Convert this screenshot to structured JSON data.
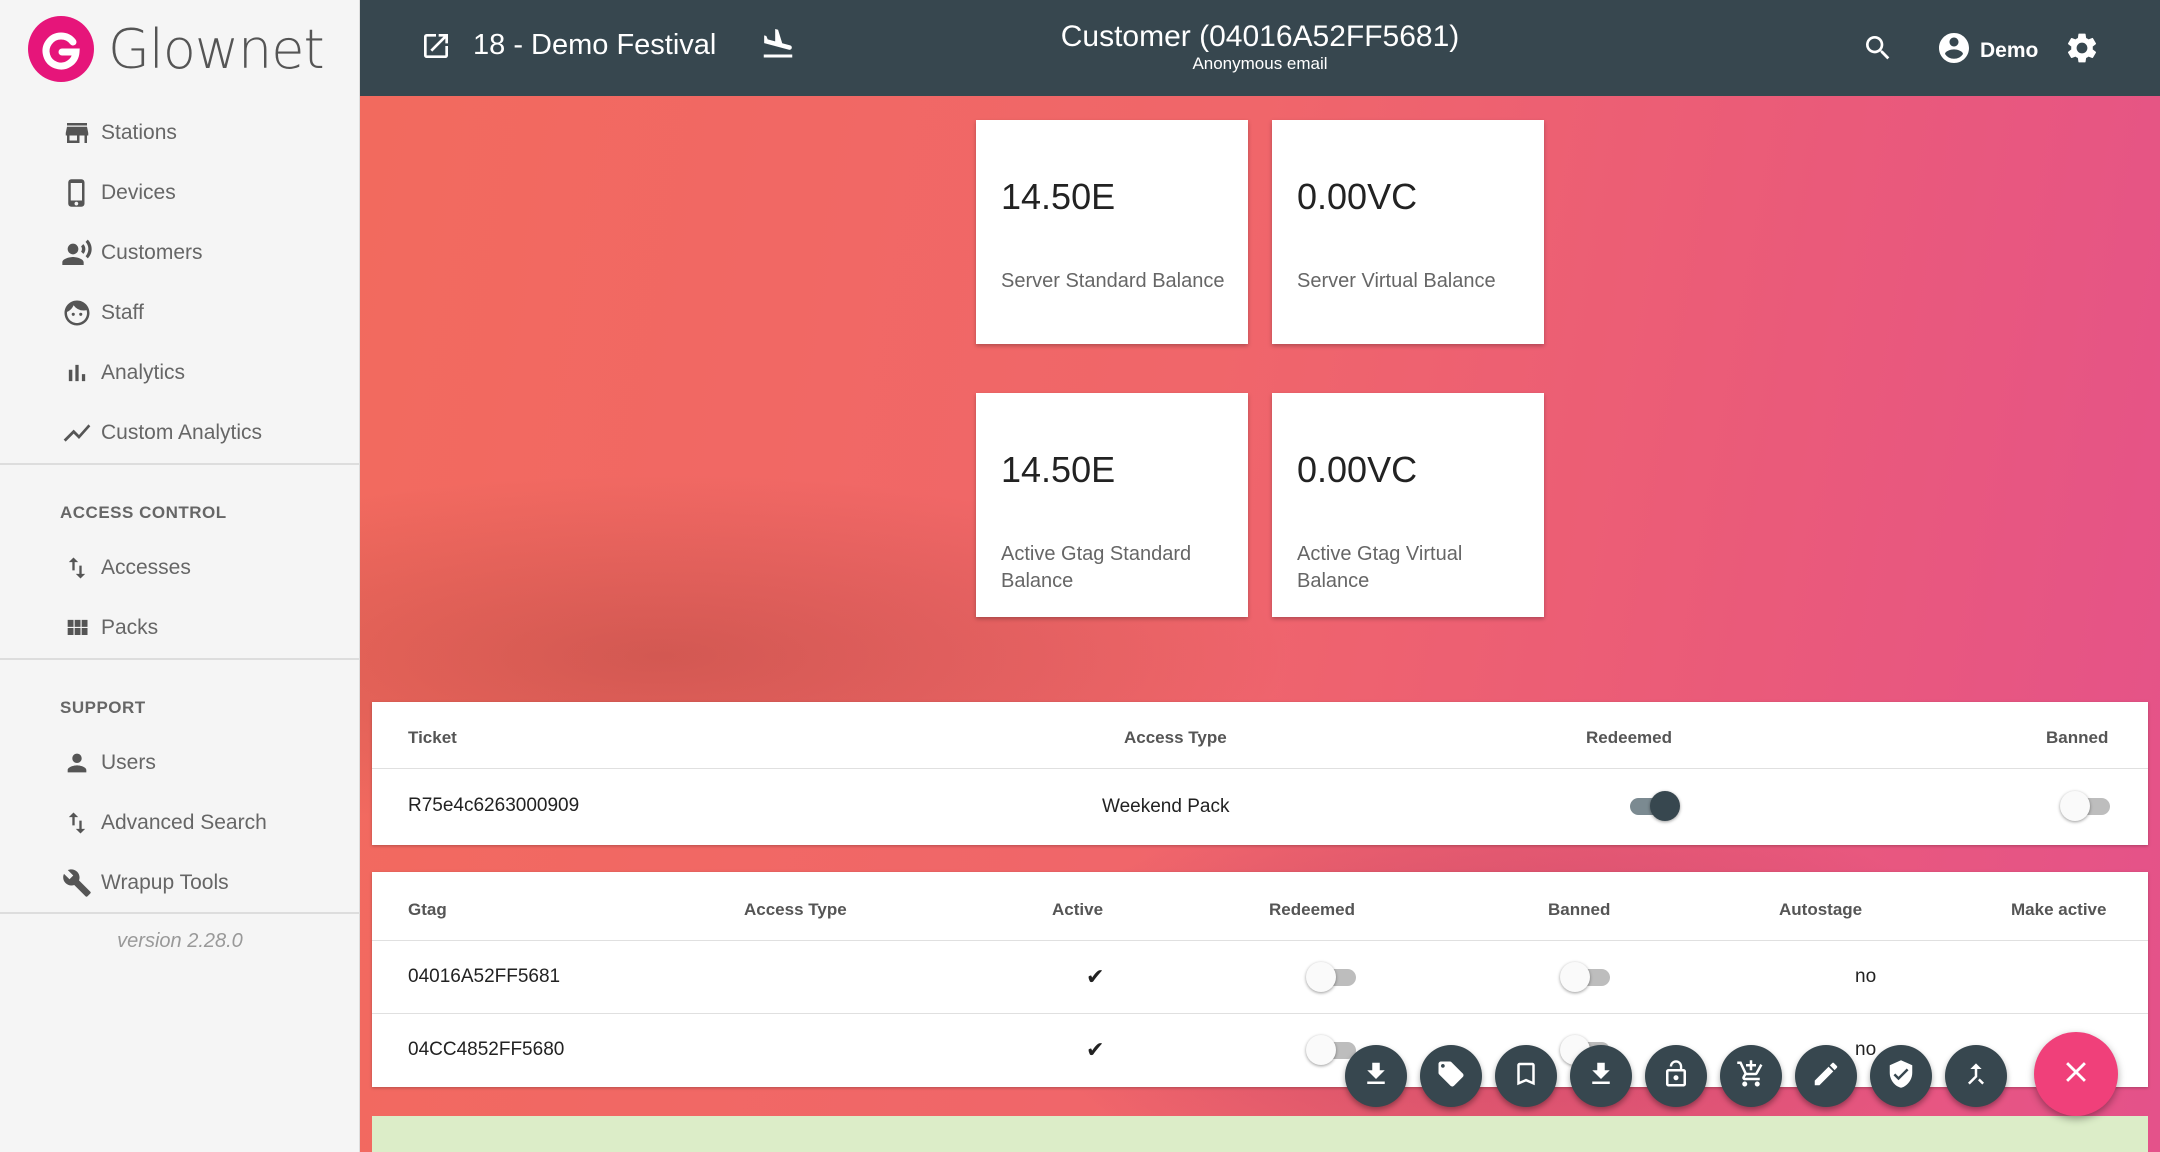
{
  "app": {
    "name": "Glownet",
    "version": "version 2.28.0"
  },
  "sidebar": {
    "items": [
      {
        "label": "Stations",
        "icon": "store-icon"
      },
      {
        "label": "Devices",
        "icon": "phone-icon"
      },
      {
        "label": "Customers",
        "icon": "record-voice-icon"
      },
      {
        "label": "Staff",
        "icon": "face-icon"
      },
      {
        "label": "Analytics",
        "icon": "bar-chart-icon"
      },
      {
        "label": "Custom Analytics",
        "icon": "trending-up-icon"
      }
    ],
    "access_control": {
      "title": "ACCESS CONTROL",
      "items": [
        {
          "label": "Accesses",
          "icon": "swap-vert-icon"
        },
        {
          "label": "Packs",
          "icon": "grid-icon"
        }
      ]
    },
    "support": {
      "title": "SUPPORT",
      "items": [
        {
          "label": "Users",
          "icon": "person-icon"
        },
        {
          "label": "Advanced Search",
          "icon": "swap-vert-icon"
        },
        {
          "label": "Wrapup Tools",
          "icon": "wrench-icon"
        }
      ]
    }
  },
  "header": {
    "event": "18 - Demo Festival",
    "title": "Customer (04016A52FF5681)",
    "subtitle": "Anonymous email",
    "user": "Demo"
  },
  "balances": [
    {
      "value": "14.50E",
      "caption": "Server Standard Balance"
    },
    {
      "value": "0.00VC",
      "caption": "Server Virtual Balance"
    },
    {
      "value": "14.50E",
      "caption": "Active Gtag Standard Balance"
    },
    {
      "value": "0.00VC",
      "caption": "Active Gtag Virtual Balance"
    }
  ],
  "tickets": {
    "headers": {
      "ticket": "Ticket",
      "access_type": "Access Type",
      "redeemed": "Redeemed",
      "banned": "Banned"
    },
    "rows": [
      {
        "ticket": "R75e4c6263000909",
        "access_type": "Weekend Pack",
        "redeemed": true,
        "banned": false
      }
    ]
  },
  "gtags": {
    "headers": {
      "gtag": "Gtag",
      "access_type": "Access Type",
      "active": "Active",
      "redeemed": "Redeemed",
      "banned": "Banned",
      "autostage": "Autostage",
      "make_active": "Make active"
    },
    "rows": [
      {
        "gtag": "04016A52FF5681",
        "access_type": "",
        "active": "✔",
        "redeemed": false,
        "banned": false,
        "autostage": "no"
      },
      {
        "gtag": "04CC4852FF5680",
        "access_type": "",
        "active": "✔",
        "redeemed": false,
        "banned": false,
        "autostage": "no"
      }
    ]
  },
  "fab_actions": [
    "download-icon",
    "tag-icon",
    "bookmark-icon",
    "download-icon",
    "lock-open-icon",
    "add-cart-icon",
    "edit-icon",
    "verified-icon",
    "merge-icon"
  ],
  "colors": {
    "header": "#37474f",
    "accent": "#e6157a",
    "fab": "#f0407a"
  }
}
